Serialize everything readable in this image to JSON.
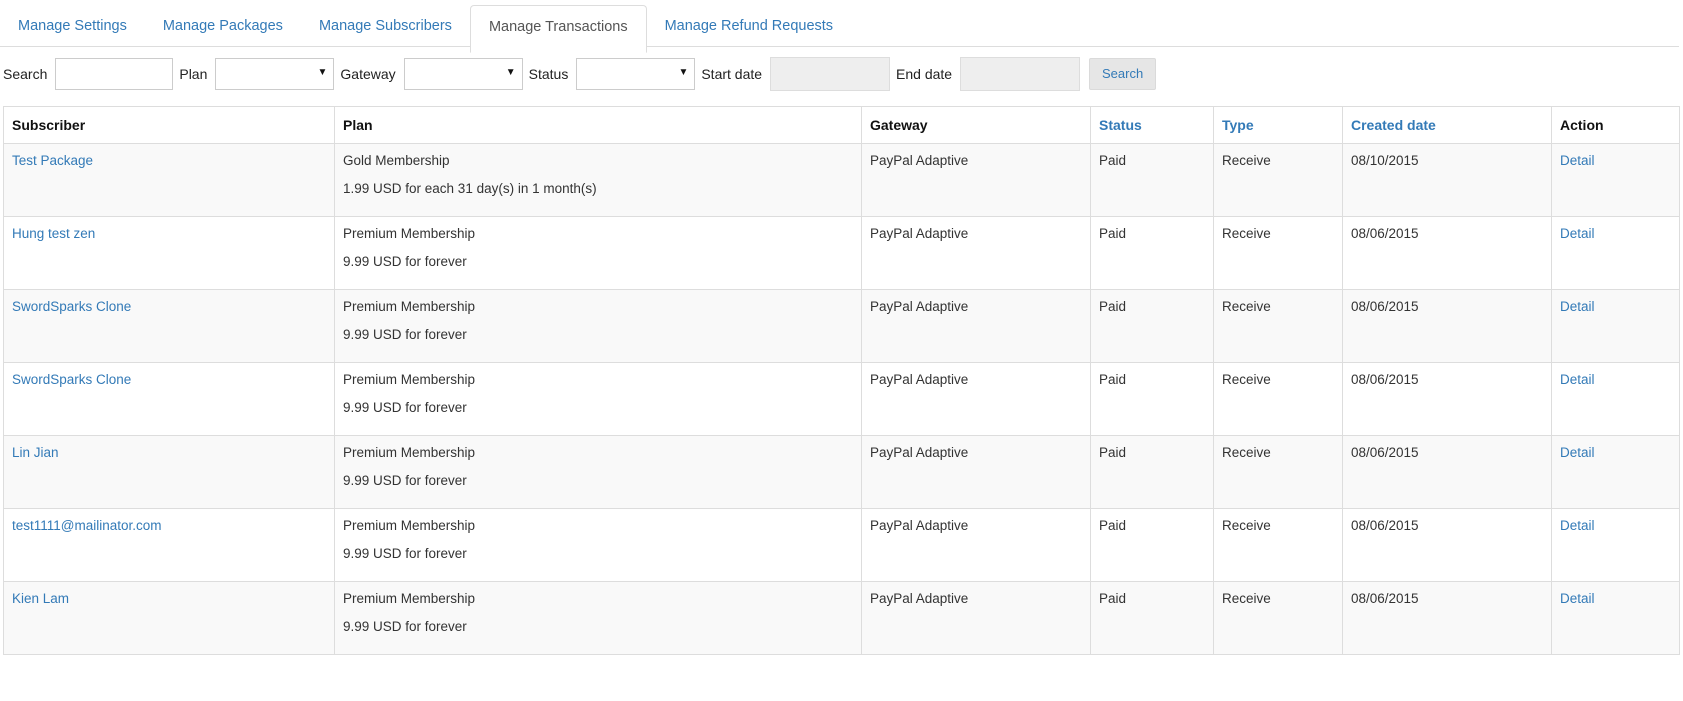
{
  "tabs": [
    {
      "label": "Manage Settings",
      "active": false
    },
    {
      "label": "Manage Packages",
      "active": false
    },
    {
      "label": "Manage Subscribers",
      "active": false
    },
    {
      "label": "Manage Transactions",
      "active": true
    },
    {
      "label": "Manage Refund Requests",
      "active": false
    }
  ],
  "filters": {
    "search_label": "Search",
    "search_value": "",
    "plan_label": "Plan",
    "plan_value": "",
    "gateway_label": "Gateway",
    "gateway_value": "",
    "status_label": "Status",
    "status_value": "",
    "start_date_label": "Start date",
    "start_date_value": "",
    "end_date_label": "End date",
    "end_date_value": "",
    "search_button": "Search"
  },
  "table": {
    "headers": {
      "subscriber": "Subscriber",
      "plan": "Plan",
      "gateway": "Gateway",
      "status": "Status",
      "type": "Type",
      "created_date": "Created date",
      "action": "Action"
    },
    "rows": [
      {
        "subscriber": "Test Package",
        "plan_name": "Gold Membership",
        "plan_desc": "1.99 USD for each 31 day(s) in 1 month(s)",
        "gateway": "PayPal Adaptive",
        "status": "Paid",
        "type": "Receive",
        "created_date": "08/10/2015",
        "action": "Detail"
      },
      {
        "subscriber": "Hung test zen",
        "plan_name": "Premium Membership",
        "plan_desc": "9.99 USD for forever",
        "gateway": "PayPal Adaptive",
        "status": "Paid",
        "type": "Receive",
        "created_date": "08/06/2015",
        "action": "Detail"
      },
      {
        "subscriber": "SwordSparks Clone",
        "plan_name": "Premium Membership",
        "plan_desc": "9.99 USD for forever",
        "gateway": "PayPal Adaptive",
        "status": "Paid",
        "type": "Receive",
        "created_date": "08/06/2015",
        "action": "Detail"
      },
      {
        "subscriber": "SwordSparks Clone",
        "plan_name": "Premium Membership",
        "plan_desc": "9.99 USD for forever",
        "gateway": "PayPal Adaptive",
        "status": "Paid",
        "type": "Receive",
        "created_date": "08/06/2015",
        "action": "Detail"
      },
      {
        "subscriber": "Lin Jian",
        "plan_name": "Premium Membership",
        "plan_desc": "9.99 USD for forever",
        "gateway": "PayPal Adaptive",
        "status": "Paid",
        "type": "Receive",
        "created_date": "08/06/2015",
        "action": "Detail"
      },
      {
        "subscriber": "test1111@mailinator.com",
        "plan_name": "Premium Membership",
        "plan_desc": "9.99 USD for forever",
        "gateway": "PayPal Adaptive",
        "status": "Paid",
        "type": "Receive",
        "created_date": "08/06/2015",
        "action": "Detail"
      },
      {
        "subscriber": "Kien Lam",
        "plan_name": "Premium Membership",
        "plan_desc": "9.99 USD for forever",
        "gateway": "PayPal Adaptive",
        "status": "Paid",
        "type": "Receive",
        "created_date": "08/06/2015",
        "action": "Detail"
      }
    ]
  },
  "icons": {
    "select_caret": "caret-down-icon"
  },
  "colors": {
    "link": "#337ab7",
    "border": "#dddddd",
    "stripe": "#f9f9f9"
  }
}
